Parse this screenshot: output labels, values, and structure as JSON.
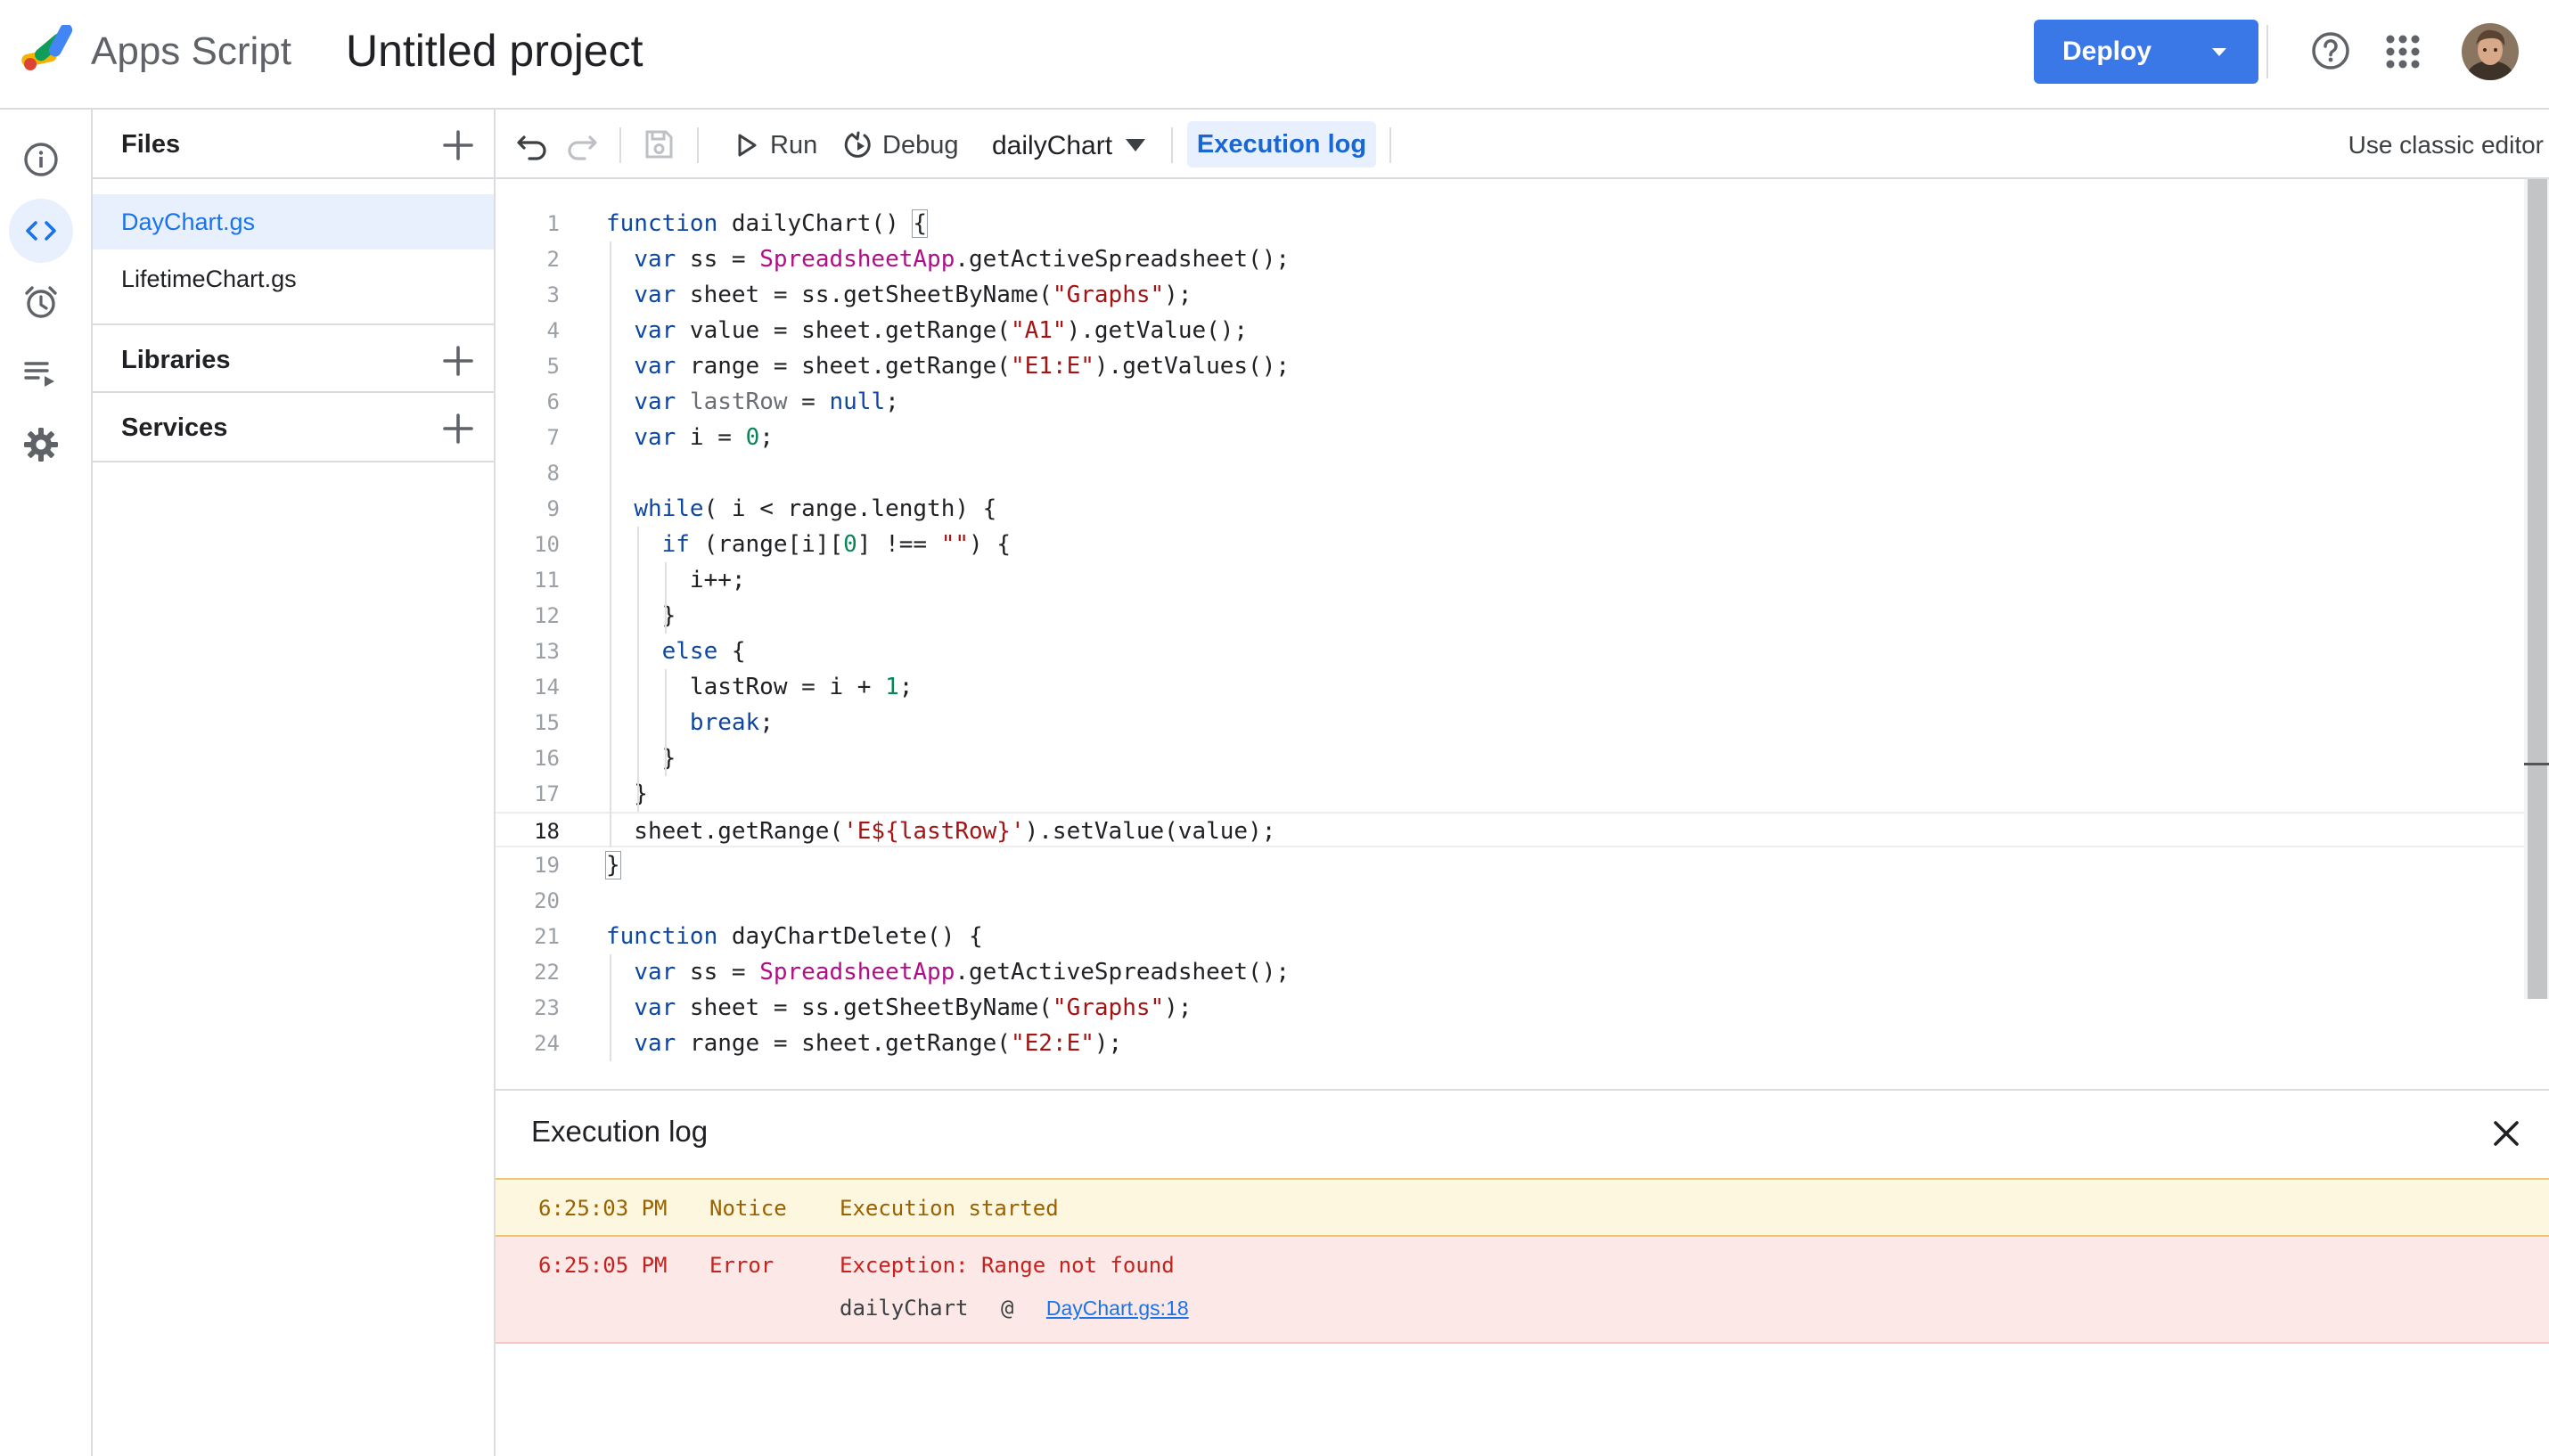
{
  "header": {
    "app_name": "Apps Script",
    "project_title": "Untitled project",
    "deploy_label": "Deploy",
    "accent_color": "#3b78e7"
  },
  "rail": {
    "items": [
      {
        "name": "overview",
        "icon": "info-icon",
        "active": false
      },
      {
        "name": "editor",
        "icon": "code-icon",
        "active": true
      },
      {
        "name": "triggers",
        "icon": "alarm-clock-icon",
        "active": false
      },
      {
        "name": "executions",
        "icon": "executions-list-icon",
        "active": false
      },
      {
        "name": "project-settings",
        "icon": "gear-icon",
        "active": false
      }
    ]
  },
  "files_panel": {
    "files_heading": "Files",
    "files": [
      {
        "label": "DayChart.gs",
        "active": true
      },
      {
        "label": "LifetimeChart.gs",
        "active": false
      }
    ],
    "libraries_heading": "Libraries",
    "services_heading": "Services"
  },
  "toolbar": {
    "run_label": "Run",
    "debug_label": "Debug",
    "function_select": "dailyChart",
    "execution_log_label": "Execution log",
    "classic_editor_label": "Use classic editor"
  },
  "editor": {
    "current_line": 18,
    "lines": [
      "function dailyChart() {",
      "  var ss = SpreadsheetApp.getActiveSpreadsheet();",
      "  var sheet = ss.getSheetByName(\"Graphs\");",
      "  var value = sheet.getRange(\"A1\").getValue();",
      "  var range = sheet.getRange(\"E1:E\").getValues();",
      "  var lastRow = null;",
      "  var i = 0;",
      "",
      "  while( i < range.length) {",
      "    if (range[i][0] !== \"\") {",
      "      i++;",
      "    }",
      "    else {",
      "      lastRow = i + 1;",
      "      break;",
      "    }",
      "  }",
      "  sheet.getRange('E${lastRow}').setValue(value);",
      "}",
      "",
      "function dayChartDelete() {",
      "  var ss = SpreadsheetApp.getActiveSpreadsheet();",
      "  var sheet = ss.getSheetByName(\"Graphs\");",
      "  var range = sheet.getRange(\"E2:E\");"
    ]
  },
  "execution_log": {
    "title": "Execution log",
    "entries": [
      {
        "time": "6:25:03 PM",
        "level": "Notice",
        "message": "Execution started"
      },
      {
        "time": "6:25:05 PM",
        "level": "Error",
        "message": "Exception: Range not found",
        "trace_function": "dailyChart",
        "trace_at": "@",
        "trace_link": "DayChart.gs:18"
      }
    ]
  }
}
